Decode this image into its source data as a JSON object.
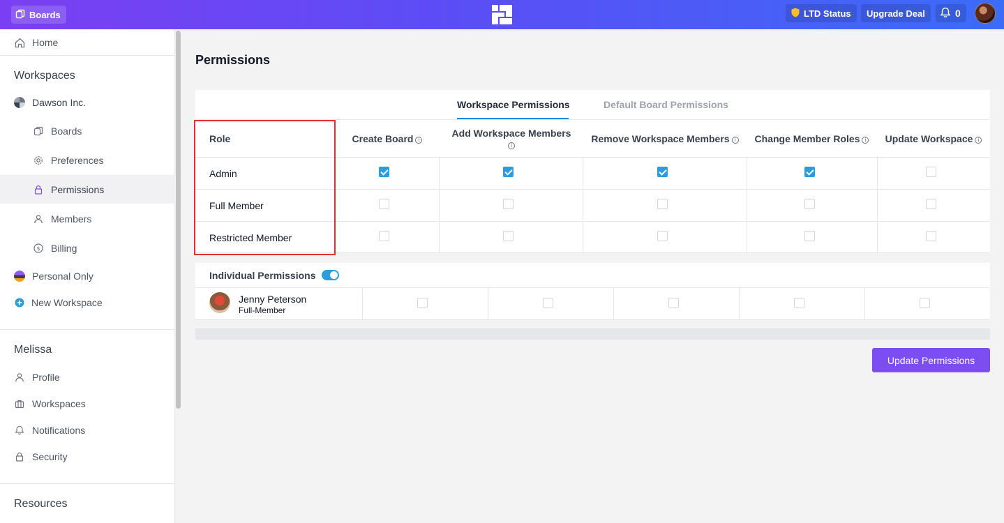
{
  "topbar": {
    "boards_label": "Boards",
    "ltd_label": "LTD Status",
    "upgrade_label": "Upgrade Deal",
    "notif_count": "0",
    "accent_start": "#7b3ff2",
    "accent_end": "#3b6cf8"
  },
  "sidebar": {
    "home": "Home",
    "workspaces_title": "Workspaces",
    "workspace_name": "Dawson Inc.",
    "items": [
      {
        "label": "Boards",
        "icon": "boards-icon"
      },
      {
        "label": "Preferences",
        "icon": "gear-icon"
      },
      {
        "label": "Permissions",
        "icon": "lock-icon"
      },
      {
        "label": "Members",
        "icon": "user-icon"
      },
      {
        "label": "Billing",
        "icon": "dollar-icon"
      }
    ],
    "personal": "Personal Only",
    "new_workspace": "New Workspace",
    "user_title": "Melissa",
    "user_items": [
      {
        "label": "Profile",
        "icon": "user-icon"
      },
      {
        "label": "Workspaces",
        "icon": "briefcase-icon"
      },
      {
        "label": "Notifications",
        "icon": "bell-icon"
      },
      {
        "label": "Security",
        "icon": "lock-icon"
      }
    ],
    "resources_title": "Resources"
  },
  "main": {
    "title": "Permissions",
    "tabs": [
      "Workspace Permissions",
      "Default Board Permissions"
    ],
    "columns": {
      "role": "Role",
      "create_board": "Create Board",
      "add_members": "Add Workspace Members",
      "remove_members": "Remove Workspace Members",
      "change_roles": "Change Member Roles",
      "update_workspace": "Update Workspace"
    },
    "roles": [
      {
        "name": "Admin",
        "perms": [
          true,
          true,
          true,
          true,
          false
        ]
      },
      {
        "name": "Full Member",
        "perms": [
          false,
          false,
          false,
          false,
          false
        ]
      },
      {
        "name": "Restricted Member",
        "perms": [
          false,
          false,
          false,
          false,
          false
        ]
      }
    ],
    "individual_title": "Individual Permissions",
    "individual_user": {
      "name": "Jenny Peterson",
      "role": "Full-Member",
      "perms": [
        false,
        false,
        false,
        false,
        false
      ]
    },
    "update_button": "Update Permissions",
    "checkbox_color": "#2d9cdb",
    "button_color": "#7c4df1",
    "highlight_color": "#e03131"
  }
}
